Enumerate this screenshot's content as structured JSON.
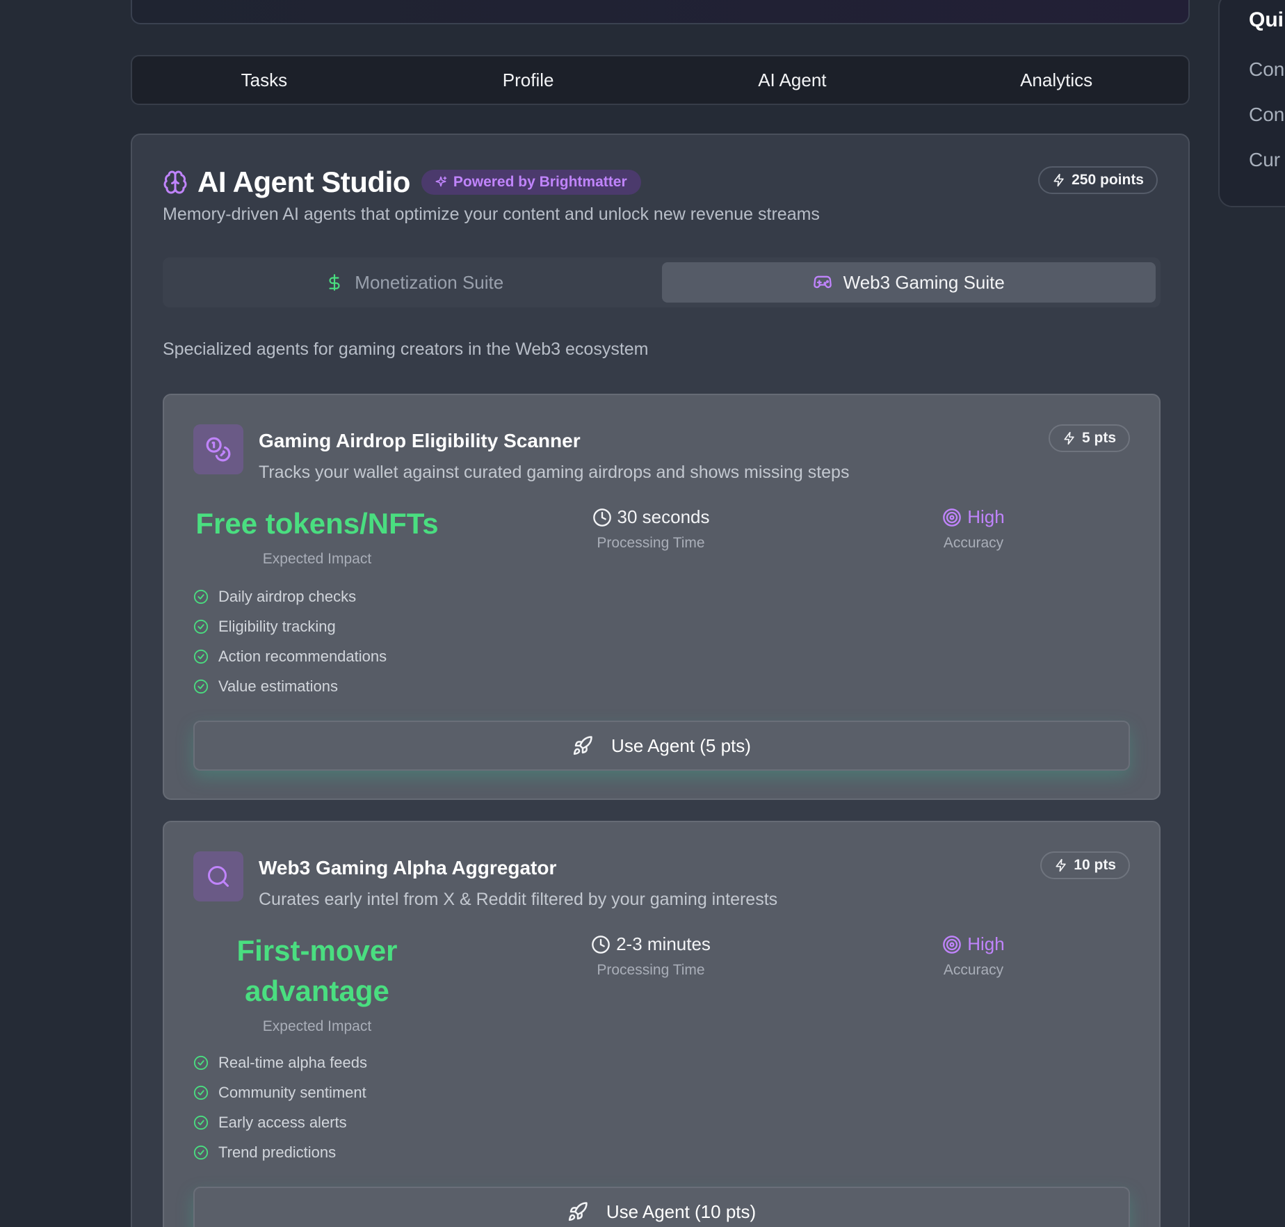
{
  "nav_tabs": [
    "Tasks",
    "Profile",
    "AI Agent",
    "Analytics"
  ],
  "quick_panel": {
    "title": "Qui",
    "items": [
      "Con",
      "Con",
      "Cur"
    ]
  },
  "studio": {
    "title": "AI Agent Studio",
    "powered_by": "Powered by Brightmatter",
    "points": "250 points",
    "subtitle": "Memory-driven AI agents that optimize your content and unlock new revenue streams",
    "suite_tabs": [
      {
        "label": "Monetization Suite",
        "icon": "dollar-icon",
        "active": false
      },
      {
        "label": "Web3 Gaming Suite",
        "icon": "gamepad-icon",
        "active": true
      }
    ],
    "section_description": "Specialized agents for gaming creators in the Web3 ecosystem"
  },
  "agents": [
    {
      "icon": "coins-icon",
      "title": "Gaming Airdrop Eligibility Scanner",
      "description": "Tracks your wallet against curated gaming airdrops and shows missing steps",
      "points": "5 pts",
      "impact_lines": [
        "Free tokens/NFTs"
      ],
      "impact_label": "Expected Impact",
      "processing_time": "30 seconds",
      "processing_label": "Processing Time",
      "accuracy": "High",
      "accuracy_label": "Accuracy",
      "features": [
        "Daily airdrop checks",
        "Eligibility tracking",
        "Action recommendations",
        "Value estimations"
      ],
      "button": "Use Agent (5 pts)"
    },
    {
      "icon": "search-icon",
      "title": "Web3 Gaming Alpha Aggregator",
      "description": "Curates early intel from X & Reddit filtered by your gaming interests",
      "points": "10 pts",
      "impact_lines": [
        "First-mover",
        "advantage"
      ],
      "impact_label": "Expected Impact",
      "processing_time": "2-3 minutes",
      "processing_label": "Processing Time",
      "accuracy": "High",
      "accuracy_label": "Accuracy",
      "features": [
        "Real-time alpha feeds",
        "Community sentiment",
        "Early access alerts",
        "Trend predictions"
      ],
      "button": "Use Agent (10 pts)"
    }
  ],
  "colors": {
    "accent_purple": "#c084fc",
    "accent_green": "#4ade80",
    "background": "#252b36"
  }
}
